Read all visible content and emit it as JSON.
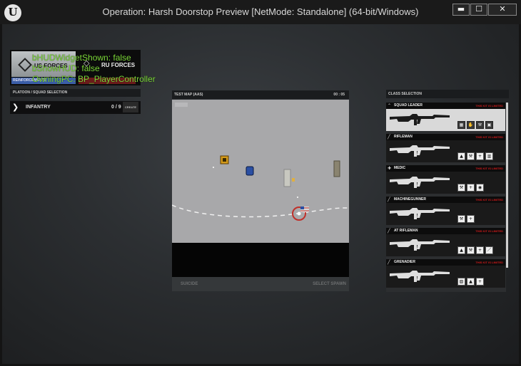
{
  "window": {
    "logo": "U",
    "title": "Operation: Harsh Doorstop Preview [NetMode: Standalone] (64-bit/Windows)",
    "minimize": "▬",
    "maximize": "☐",
    "close": "✕"
  },
  "hud": {
    "us_forces": "US FORCES",
    "ru_forces": "RU FORCES",
    "reinforcements": "REINFORCEMENTS",
    "debug": [
      "bHUDWidgetShown: false",
      "bShowHUD: false",
      "OwningPC: BP_PlayerController"
    ]
  },
  "platoon": {
    "header": "PLATOON / SQUAD SELECTION",
    "arrow": "❯",
    "name": "INFANTRY",
    "count": "0 / 9",
    "create": "CREATE"
  },
  "map": {
    "title": "TEST MAP (AAS)",
    "time": "00 : 05",
    "suicide": "SUICIDE",
    "select_spawn": "SELECT SPAWN"
  },
  "classes": {
    "header": "CLASS SELECTION",
    "items": [
      {
        "name": "SQUAD LEADER",
        "limit": "THIS KIT IS LIMITED",
        "icon": "chevrons-icon",
        "gear": [
          "▦",
          "✋",
          "⚒",
          "▣"
        ]
      },
      {
        "name": "RIFLEMAN",
        "limit": "THIS KIT IS LIMITED",
        "icon": "rifle-icon",
        "gear": [
          "▲",
          "⚒",
          "+",
          "▥"
        ]
      },
      {
        "name": "MEDIC",
        "limit": "THIS KIT IS LIMITED",
        "icon": "medic-cross-icon",
        "gear": [
          "⚒",
          "+",
          "◉"
        ]
      },
      {
        "name": "MACHINEGUNNER",
        "limit": "THIS KIT IS LIMITED",
        "icon": "rifle-icon",
        "gear": [
          "⚒",
          "+"
        ]
      },
      {
        "name": "AT RIFLEMAN",
        "limit": "THIS KIT IS LIMITED",
        "icon": "rifle-icon",
        "gear": [
          "▲",
          "⚒",
          "+",
          "／"
        ]
      },
      {
        "name": "GRENADIER",
        "limit": "THIS KIT IS LIMITED",
        "icon": "rifle-icon",
        "gear": [
          "▨",
          "▲",
          "+"
        ]
      }
    ]
  },
  "colors": {
    "debug_text": "#7dd93a",
    "kit_limited": "#d01a1a",
    "us_team": "#3b5ea8",
    "ru_team": "#6b1a1a"
  }
}
